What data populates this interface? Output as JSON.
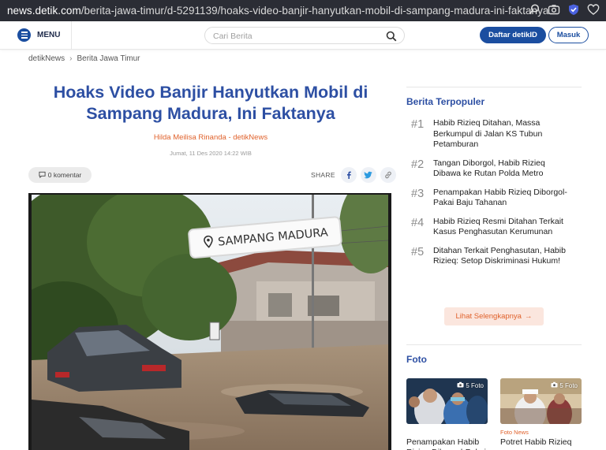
{
  "browser": {
    "url_domain": "news.detik.com",
    "url_path": "/berita-jawa-timur/d-5291139/hoaks-video-banjir-hanyutkan-mobil-di-sampang-madura-ini-faktanya"
  },
  "header": {
    "menu_label": "MENU",
    "search_placeholder": "Cari Berita",
    "register_label": "Daftar detikID",
    "login_label": "Masuk"
  },
  "breadcrumb": [
    "detikNews",
    "Berita Jawa Timur"
  ],
  "article": {
    "title": "Hoaks Video Banjir Hanyutkan Mobil di Sampang Madura, Ini Faktanya",
    "author": "Hilda Meilisa Rinanda - detikNews",
    "date": "Jumat, 11 Des 2020 14:22 WIB",
    "comments": "0 komentar",
    "share_label": "SHARE",
    "image_caption_overlay": "SAMPANG MADURA"
  },
  "sidebar": {
    "popular_heading": "Berita Terpopuler",
    "popular": [
      {
        "num": "#1",
        "text": "Habib Rizieq Ditahan, Massa Berkumpul di Jalan KS Tubun Petamburan"
      },
      {
        "num": "#2",
        "text": "Tangan Diborgol, Habib Rizieq Dibawa ke Rutan Polda Metro"
      },
      {
        "num": "#3",
        "text": "Penampakan Habib Rizieq Diborgol-Pakai Baju Tahanan"
      },
      {
        "num": "#4",
        "text": "Habib Rizieq Resmi Ditahan Terkait Kasus Penghasutan Kerumunan"
      },
      {
        "num": "#5",
        "text": "Ditahan Terkait Penghasutan, Habib Rizieq: Setop Diskriminasi Hukum!"
      }
    ],
    "more_label": "Lihat Selengkapnya",
    "foto_heading": "Foto",
    "foto": [
      {
        "badge": "5 Foto",
        "label": "",
        "title": "Penampakan Habib Rizieq Diborgol-Pakai"
      },
      {
        "badge": "5 Foto",
        "label": "Foto News",
        "title": "Potret Habib Rizieq"
      }
    ]
  },
  "colors": {
    "brand_blue": "#1b4ea0",
    "title_blue": "#2d4fa3",
    "accent_orange": "#e0622c",
    "urlbar_bg": "#2b2d35"
  }
}
